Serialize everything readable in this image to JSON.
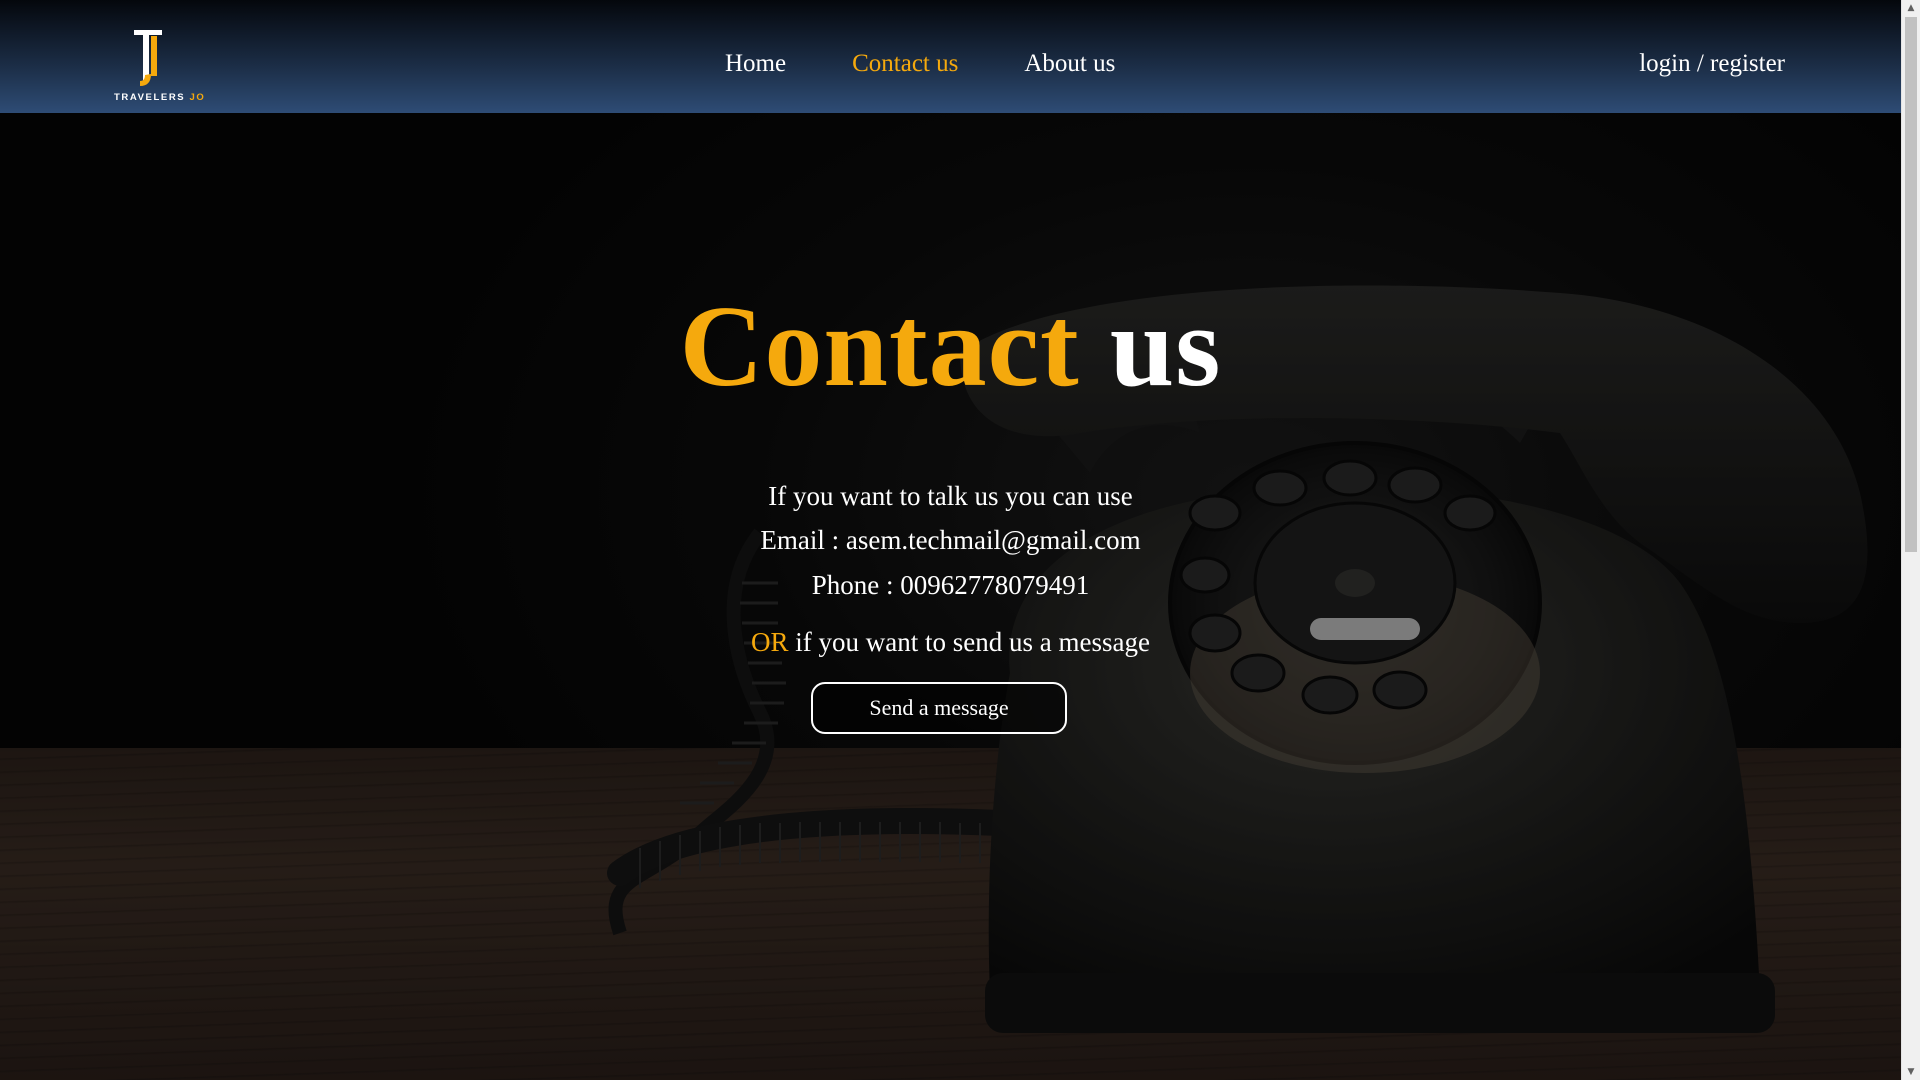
{
  "brand": {
    "logo_letters": "TJ",
    "name_main": "TRAVELERS",
    "name_accent": "JO"
  },
  "nav": {
    "items": [
      {
        "label": "Home"
      },
      {
        "label": "Contact us"
      },
      {
        "label": "About us"
      }
    ],
    "active_item": "Contact us",
    "auth_label": "login / register"
  },
  "hero": {
    "heading_part1": "Contact",
    "heading_part2": "us",
    "intro": "If you want to talk us you can use",
    "email_line": "Email : asem.techmail@gmail.com",
    "phone_line": "Phone : 00962778079491",
    "or_word": "OR",
    "message_prompt": " if you want to send us a message",
    "button_label": "Send a message"
  },
  "colors": {
    "accent": "#f5a90d",
    "text": "#ffffff",
    "navbar_top": "#04070c",
    "navbar_bottom": "#2e4c75"
  },
  "scrollbar": {
    "up_icon": "scroll-up-arrow-icon",
    "down_icon": "scroll-down-arrow-icon"
  }
}
